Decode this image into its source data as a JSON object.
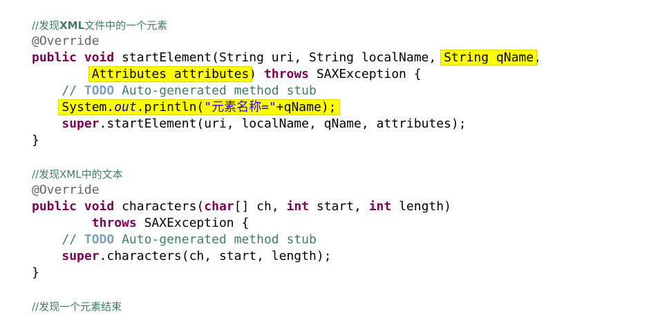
{
  "code": {
    "comment_start_element": {
      "prefix": "//发现",
      "bold": "XML",
      "suffix": "文件中的一个元素"
    },
    "override_1": "@Override",
    "sig1": {
      "kw_public": "public",
      "kw_void": "void",
      "text_a": " startElement(String uri, String localName, ",
      "hl_qname": "String qName",
      "text_b": ","
    },
    "sig1_cont": {
      "indent": "        ",
      "hl_attributes": "Attributes attributes",
      "text_a": ") ",
      "kw_throws": "throws",
      "text_b": " SAXException {"
    },
    "todo_1": {
      "indent": "    ",
      "slashes": "// ",
      "todo": "TODO",
      "rest": " Auto-generated method stub"
    },
    "println": {
      "indent": "    ",
      "a": "System.",
      "out": "out",
      "b": ".println(",
      "str": "\"元素名称=\"",
      "c": "+qName);"
    },
    "super_1": {
      "indent": "    ",
      "kw_super": "super",
      "rest": ".startElement(uri, localName, qName, attributes);"
    },
    "close_1": "}",
    "comment_characters": "//发现XML中的文本",
    "override_2": "@Override",
    "sig2": {
      "kw_public": "public",
      "kw_void": "void",
      "text_a": " characters(",
      "kw_char": "char",
      "text_b": "[] ch, ",
      "kw_int1": "int",
      "text_c": " start, ",
      "kw_int2": "int",
      "text_d": " length)"
    },
    "sig2_cont": {
      "indent": "        ",
      "kw_throws": "throws",
      "text": " SAXException {"
    },
    "todo_2": {
      "indent": "    ",
      "slashes": "// ",
      "todo": "TODO",
      "rest": " Auto-generated method stub"
    },
    "super_2": {
      "indent": "    ",
      "kw_super": "super",
      "rest": ".characters(ch, start, length);"
    },
    "close_2": "}",
    "comment_end_element": "//发现一个元素结束"
  },
  "colors": {
    "keyword": "#7f0055",
    "comment": "#3f7f5f",
    "todo": "#7f9fbf",
    "annotation": "#646464",
    "string": "#2a00ff",
    "field": "#0000c0",
    "highlight": "#ffff00"
  }
}
